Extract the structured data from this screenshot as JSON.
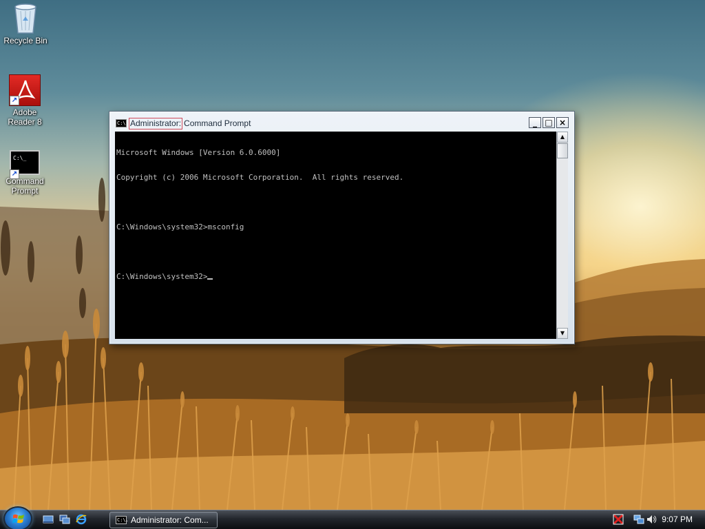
{
  "desktop": {
    "icons": [
      {
        "label": "Recycle Bin",
        "icon": "recycle-bin-icon"
      },
      {
        "label": "Adobe Reader 8",
        "icon": "adobe-reader-icon"
      },
      {
        "label": "Command Prompt",
        "icon": "command-prompt-icon"
      }
    ]
  },
  "window": {
    "title_admin": "Administrator:",
    "title_rest": "Command Prompt",
    "icon_text": "C:\\.",
    "buttons": {
      "minimize": "_",
      "maximize": "□",
      "close": "×"
    },
    "console_lines": [
      "Microsoft Windows [Version 6.0.6000]",
      "Copyright (c) 2006 Microsoft Corporation.  All rights reserved.",
      "",
      "C:\\Windows\\system32>msconfig",
      "",
      "C:\\Windows\\system32>"
    ]
  },
  "taskbar": {
    "task_button_label": "Administrator: Com...",
    "clock": "9:07 PM"
  },
  "colors": {
    "console_bg": "#000000",
    "console_text": "#c0c0c0",
    "taskbar": "#1a1d22"
  }
}
